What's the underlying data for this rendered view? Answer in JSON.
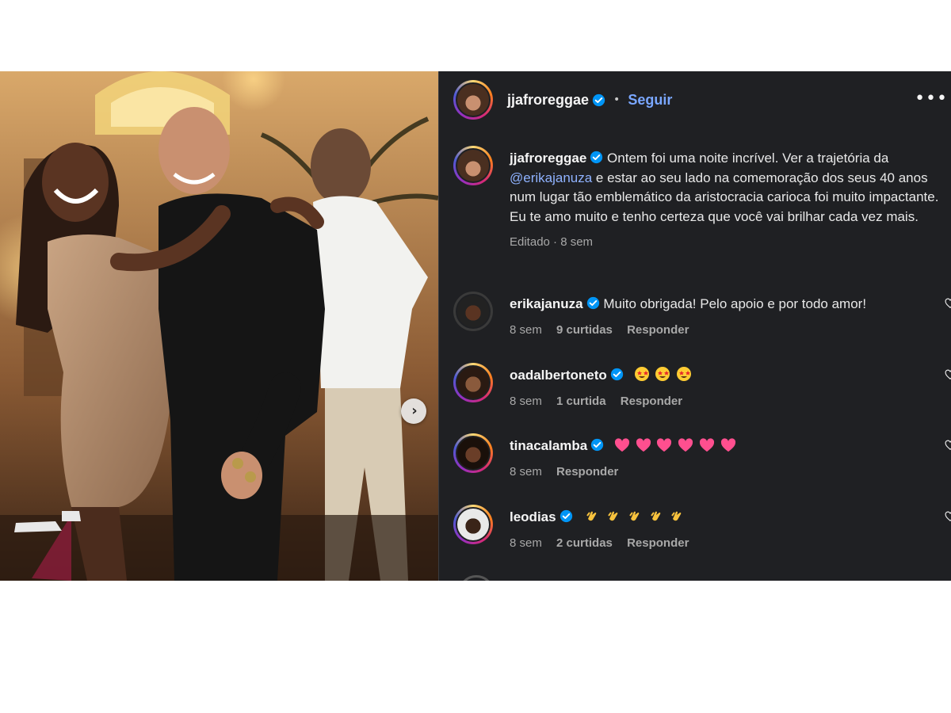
{
  "post": {
    "username": "jjafroreggae",
    "follow_label": "Seguir",
    "separator": "•",
    "more_label": "•••",
    "caption_text_before": "Ontem foi uma noite incrível. Ver a trajetória da ",
    "caption_mention": "@erikajanuza",
    "caption_text_after": " e estar ao seu lado na comemoração dos seus 40 anos num lugar tão emblemático da aristocracia carioca foi muito impactante. Eu te amo muito e tenho certeza que você vai brilhar cada vez mais.",
    "caption_meta": "Editado · 8 sem",
    "next_label": "›"
  },
  "comments": [
    {
      "username": "erikajanuza",
      "text": "Muito obrigada! Pelo apoio e por todo amor!",
      "time": "8 sem",
      "likes": "9 curtidas",
      "reply": "Responder"
    },
    {
      "username": "oadalbertoneto",
      "text": "",
      "emoji": "star-struck x3",
      "time": "8 sem",
      "likes": "1 curtida",
      "reply": "Responder"
    },
    {
      "username": "tinacalamba",
      "text": "",
      "emoji": "pink-heart x6",
      "time": "8 sem",
      "likes": "",
      "reply": "Responder"
    },
    {
      "username": "leodias",
      "text": "",
      "emoji": "clapping-hands x5",
      "time": "8 sem",
      "likes": "2 curtidas",
      "reply": "Responder"
    }
  ],
  "colors": {
    "panel_bg": "#1f2023",
    "link_blue": "#7aa7ff",
    "verified_blue": "#0095f6",
    "meta_gray": "#a8a8a8"
  },
  "icons": [
    "verified-badge-icon",
    "chevron-right-icon",
    "more-options-icon",
    "heart-icon"
  ]
}
